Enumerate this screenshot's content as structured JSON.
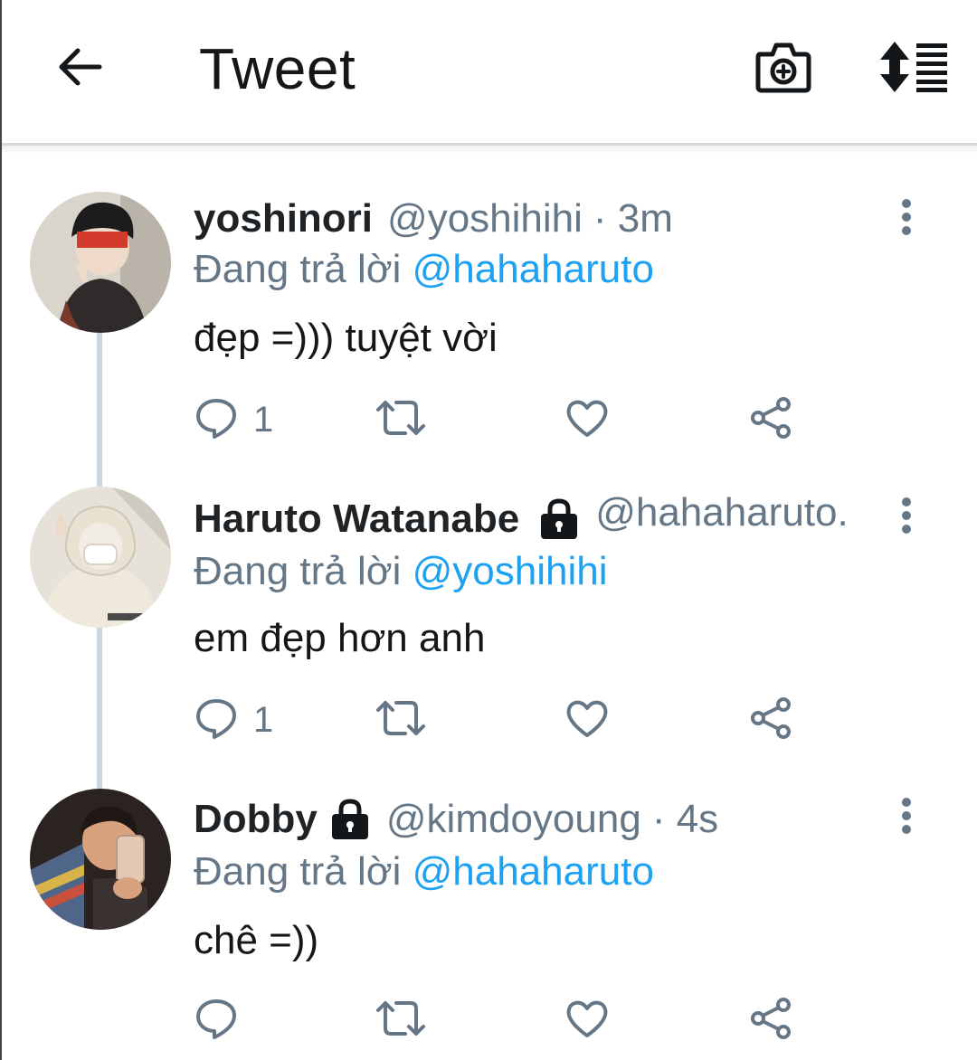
{
  "header": {
    "title": "Tweet",
    "back_icon": "arrow-left-icon",
    "camera_icon": "camera-plus-icon",
    "sort_icon": "sort-list-icon"
  },
  "tweets": [
    {
      "display_name": "yoshinori",
      "locked": false,
      "handle": "@yoshihihi",
      "time": "· 3m",
      "reply_prefix": "Đang trả lời",
      "reply_to": "@hahaharuto",
      "text": "đẹp =))) tuyệt vời",
      "replies": "1",
      "avatar_colors": [
        "#3a3a3a",
        "#c8402c",
        "#e8e0d8"
      ]
    },
    {
      "display_name": "Haruto Watanabe",
      "locked": true,
      "handle": "@hahaharuto.",
      "time": "",
      "reply_prefix": "Đang trả lời",
      "reply_to": "@yoshihihi",
      "text": "em đẹp hơn anh",
      "replies": "1",
      "avatar_colors": [
        "#e9e4d8",
        "#d2cbbb",
        "#f4f1ea"
      ]
    },
    {
      "display_name": "Dobby",
      "locked": true,
      "handle": "@kimdoyoung",
      "time": "· 4s",
      "reply_prefix": "Đang trả lời",
      "reply_to": "@hahaharuto",
      "text": "chê =))",
      "replies": "",
      "avatar_colors": [
        "#2c2420",
        "#d9a07a",
        "#5b6e8c"
      ]
    }
  ],
  "colors": {
    "accent": "#1da1f2",
    "secondary_text": "#657786",
    "primary_text": "#14171a",
    "thread_line": "#ccd6dd"
  }
}
